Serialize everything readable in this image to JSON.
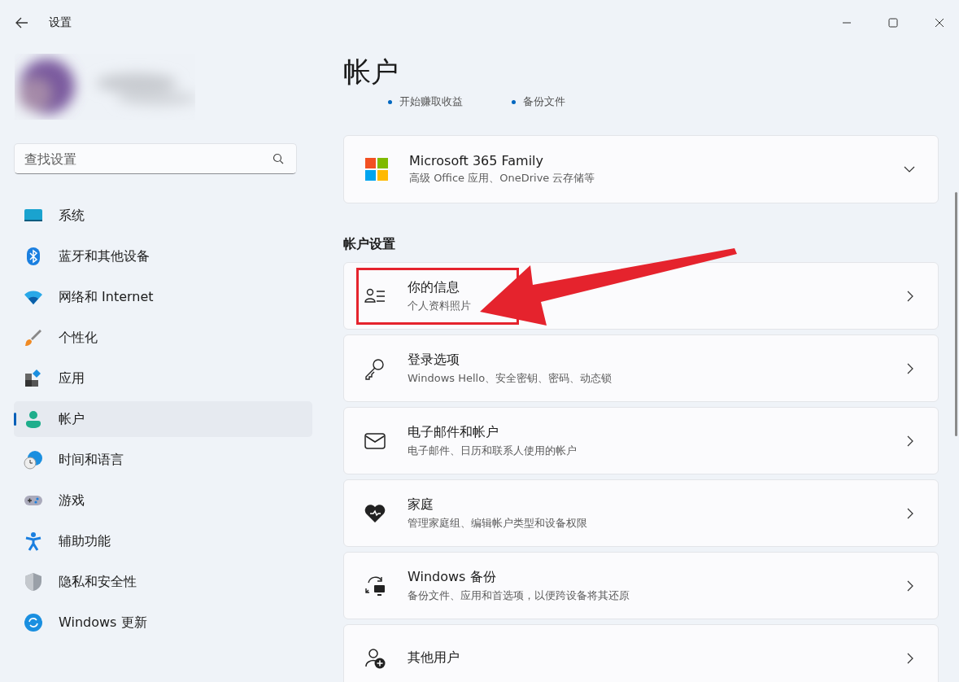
{
  "window": {
    "title": "设置"
  },
  "search": {
    "placeholder": "查找设置"
  },
  "sidebar": {
    "items": [
      {
        "label": "系统",
        "selected": false
      },
      {
        "label": "蓝牙和其他设备",
        "selected": false
      },
      {
        "label": "网络和 Internet",
        "selected": false
      },
      {
        "label": "个性化",
        "selected": false
      },
      {
        "label": "应用",
        "selected": false
      },
      {
        "label": "帐户",
        "selected": true
      },
      {
        "label": "时间和语言",
        "selected": false
      },
      {
        "label": "游戏",
        "selected": false
      },
      {
        "label": "辅助功能",
        "selected": false
      },
      {
        "label": "隐私和安全性",
        "selected": false
      },
      {
        "label": "Windows 更新",
        "selected": false
      }
    ]
  },
  "page": {
    "title": "帐户",
    "bullets": [
      "开始赚取收益",
      "备份文件"
    ],
    "subscription": {
      "title": "Microsoft 365 Family",
      "subtitle": "高级 Office 应用、OneDrive 云存储等",
      "expanded": false
    },
    "section_title": "帐户设置",
    "rows": [
      {
        "title": "你的信息",
        "subtitle": "个人资料照片",
        "highlighted": true
      },
      {
        "title": "登录选项",
        "subtitle": "Windows Hello、安全密钥、密码、动态锁",
        "highlighted": false
      },
      {
        "title": "电子邮件和帐户",
        "subtitle": "电子邮件、日历和联系人使用的帐户",
        "highlighted": false
      },
      {
        "title": "家庭",
        "subtitle": "管理家庭组、编辑帐户类型和设备权限",
        "highlighted": false
      },
      {
        "title": "Windows 备份",
        "subtitle": "备份文件、应用和首选项，以便跨设备将其还原",
        "highlighted": false
      },
      {
        "title": "其他用户",
        "highlighted": false
      }
    ]
  }
}
